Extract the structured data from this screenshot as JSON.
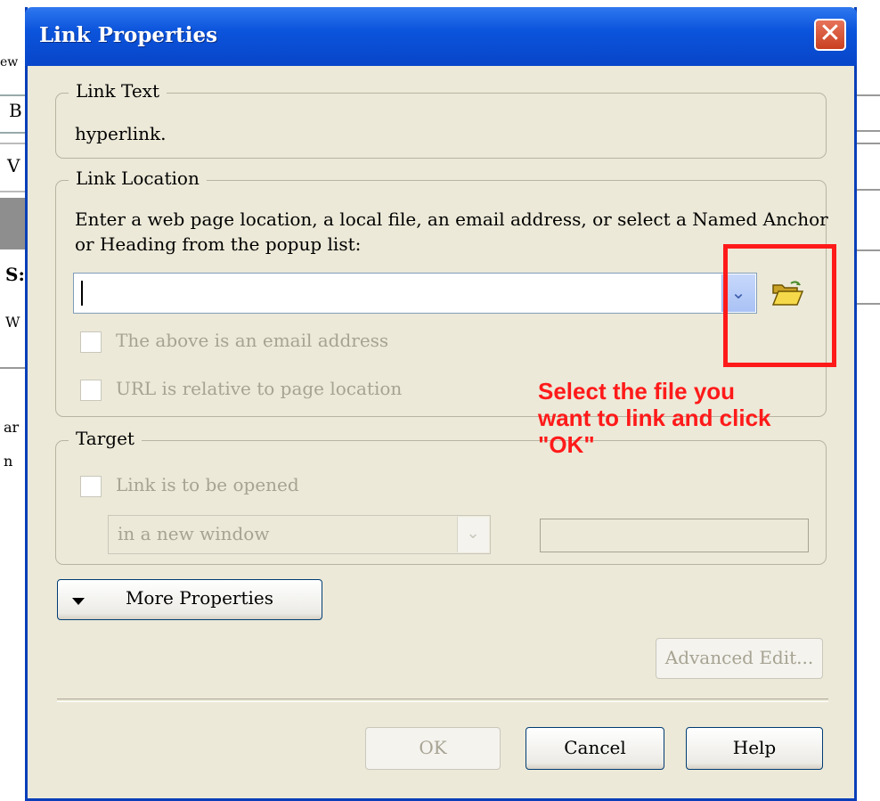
{
  "dialog": {
    "title": "Link Properties",
    "close_label": "✕"
  },
  "background": {
    "fragments": [
      "ew",
      "B",
      "V",
      "S:",
      "W",
      "ar",
      "n"
    ]
  },
  "link_text": {
    "legend": "Link Text",
    "value": "hyperlink."
  },
  "link_location": {
    "legend": "Link Location",
    "instructions_line1": "Enter a web page location, a local file, an email address, or select a Named Anchor",
    "instructions_line2": "or Heading from the popup list:",
    "url_value": "",
    "dropdown_icon": "chevron-down-icon",
    "browse_icon": "open-folder-icon",
    "checkbox_email_label": "The above is an email address",
    "checkbox_relative_label": "URL is relative to page location"
  },
  "target": {
    "legend": "Target",
    "checkbox_label": "Link is to be opened",
    "select_value": "in a new window",
    "frame_name": ""
  },
  "buttons": {
    "more_properties": "More Properties",
    "advanced_edit": "Advanced Edit...",
    "ok": "OK",
    "cancel": "Cancel",
    "help": "Help"
  },
  "annotation": {
    "line1": "Select the file you",
    "line2": "want to link and click",
    "line3": "\"OK\"",
    "color": "#ff1a1a"
  },
  "colors": {
    "titlebar": "#0b54dc",
    "dialog_bg": "#ece9d8",
    "disabled_text": "#a6a392"
  }
}
